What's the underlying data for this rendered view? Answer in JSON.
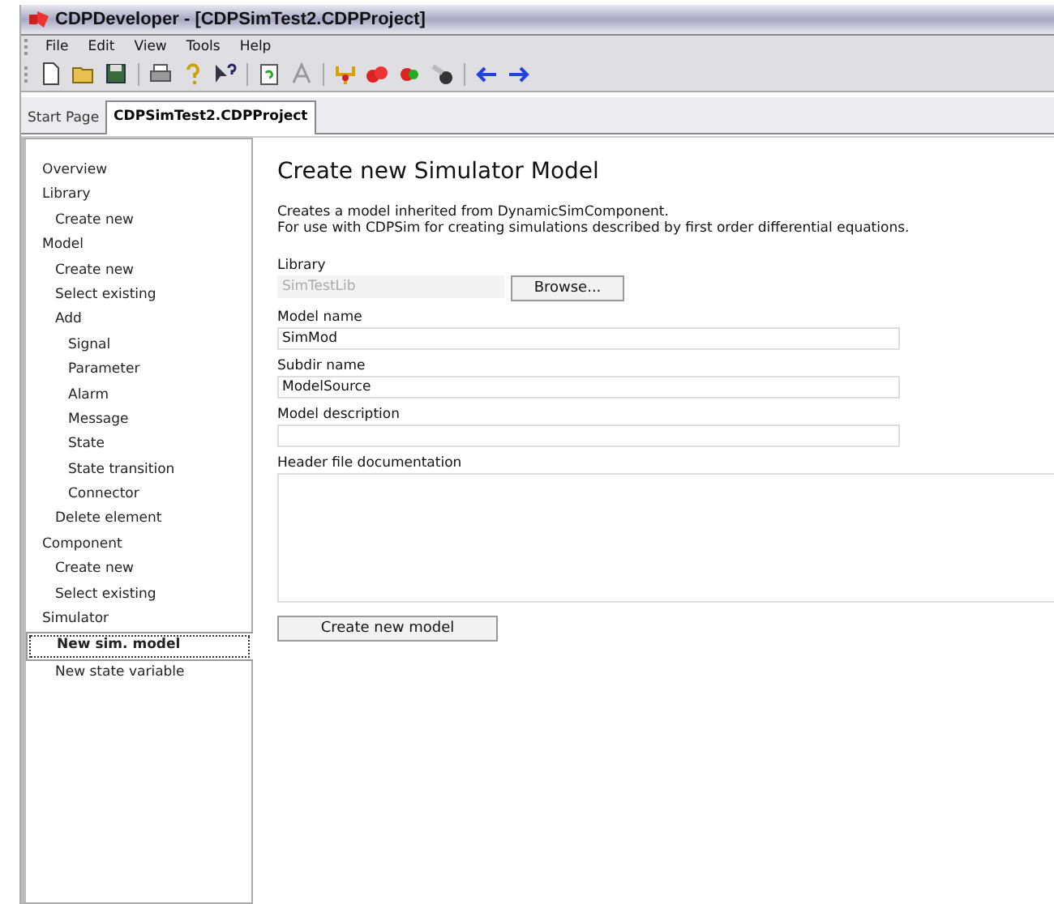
{
  "window": {
    "title": "CDPDeveloper - [CDPSimTest2.CDPProject]"
  },
  "menu": [
    "File",
    "Edit",
    "View",
    "Tools",
    "Help"
  ],
  "tabs": [
    {
      "label": "Start Page",
      "selected": false
    },
    {
      "label": "CDPSimTest2.CDPProject",
      "selected": true
    }
  ],
  "sidebar": {
    "items": [
      {
        "label": "Overview",
        "selected": false
      },
      {
        "label": "Library",
        "selected": false,
        "children": [
          {
            "label": "Create new",
            "selected": false
          }
        ]
      },
      {
        "label": "Model",
        "selected": false,
        "children": [
          {
            "label": "Create new",
            "selected": false
          },
          {
            "label": "Select existing",
            "selected": false
          },
          {
            "label": "Add",
            "selected": false,
            "children": [
              {
                "label": "Signal",
                "selected": false
              },
              {
                "label": "Parameter",
                "selected": false
              },
              {
                "label": "Alarm",
                "selected": false
              },
              {
                "label": "Message",
                "selected": false
              },
              {
                "label": "State",
                "selected": false
              },
              {
                "label": "State transition",
                "selected": false
              },
              {
                "label": "Connector",
                "selected": false
              }
            ]
          },
          {
            "label": "Delete element",
            "selected": false
          }
        ]
      },
      {
        "label": "Component",
        "selected": false,
        "children": [
          {
            "label": "Create new",
            "selected": false
          },
          {
            "label": "Select existing",
            "selected": false
          }
        ]
      },
      {
        "label": "Simulator",
        "selected": false,
        "children": [
          {
            "label": "New sim. model",
            "selected": true
          },
          {
            "label": "New state variable",
            "selected": false
          }
        ]
      }
    ]
  },
  "form": {
    "title": "Create new Simulator Model",
    "description": [
      "Creates a model inherited from DynamicSimComponent.",
      "For use with CDPSim for creating simulations described by first order differential equations."
    ],
    "library": {
      "label": "Library",
      "value": "SimTestLib",
      "disabled": true,
      "button": "Browse..."
    },
    "fields": [
      {
        "label": "Model name",
        "value": "SimMod"
      },
      {
        "label": "Subdir name",
        "value": "ModelSource"
      },
      {
        "label": "Model description"
      }
    ],
    "documentation": {
      "label": "Header file documentation"
    },
    "submit": "Create new model"
  }
}
